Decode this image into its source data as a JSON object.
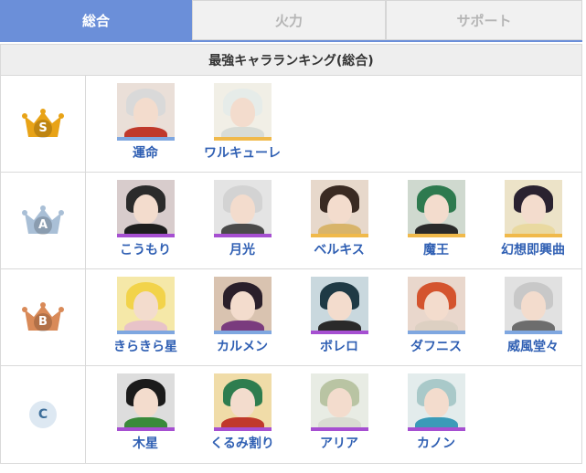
{
  "tabs": [
    {
      "label": "総合",
      "active": true
    },
    {
      "label": "火力",
      "active": false
    },
    {
      "label": "サポート",
      "active": false
    }
  ],
  "table_title": "最強キャラランキング(総合)",
  "tiers": [
    {
      "rank": "S",
      "icon": "gold-crown-icon",
      "color": "#e8a317",
      "characters": [
        {
          "name": "運命",
          "bar": "#7fa7e0",
          "hair": "#d9d9d9",
          "body": "#c0392b",
          "bg": "#eadfd8"
        },
        {
          "name": "ワルキューレ",
          "bar": "#f0b94a",
          "hair": "#e6ece9",
          "body": "#d8dcd6",
          "bg": "#f1efe6"
        }
      ]
    },
    {
      "rank": "A",
      "icon": "silver-crown-icon",
      "color": "#a9bfd6",
      "characters": [
        {
          "name": "こうもり",
          "bar": "#a64fd1",
          "hair": "#2b2b2b",
          "body": "#1e1e1e",
          "bg": "#d8cccc"
        },
        {
          "name": "月光",
          "bar": "#a64fd1",
          "hair": "#d3d3d3",
          "body": "#4a4a4a",
          "bg": "#e4e4e4"
        },
        {
          "name": "ベルキス",
          "bar": "#f0b94a",
          "hair": "#3a2a22",
          "body": "#d8b46a",
          "bg": "#e7d8cb"
        },
        {
          "name": "魔王",
          "bar": "#f0b94a",
          "hair": "#2e7a4f",
          "body": "#2a2a2a",
          "bg": "#cfd9cf"
        },
        {
          "name": "幻想即興曲",
          "bar": "#f0b94a",
          "hair": "#2a2230",
          "body": "#e9d9a0",
          "bg": "#ece3c8"
        }
      ]
    },
    {
      "rank": "B",
      "icon": "bronze-crown-icon",
      "color": "#d98a58",
      "characters": [
        {
          "name": "きらきら星",
          "bar": "#7fa7e0",
          "hair": "#f2d34a",
          "body": "#e8c3c8",
          "bg": "#f5e8a8"
        },
        {
          "name": "カルメン",
          "bar": "#7fa7e0",
          "hair": "#2a1f2a",
          "body": "#7a3b7e",
          "bg": "#d9c3b0"
        },
        {
          "name": "ボレロ",
          "bar": "#a64fd1",
          "hair": "#1f3a45",
          "body": "#2a2a2a",
          "bg": "#c9d8de"
        },
        {
          "name": "ダフニス",
          "bar": "#7fa7e0",
          "hair": "#d4542e",
          "body": "#ddd0c2",
          "bg": "#e9d7cc"
        },
        {
          "name": "威風堂々",
          "bar": "#7fa7e0",
          "hair": "#c8c8c8",
          "body": "#6d6d6d",
          "bg": "#e1e1e1"
        }
      ]
    },
    {
      "rank": "C",
      "icon": "c-rank-circle-icon",
      "color": "#3d6e9a",
      "characters": [
        {
          "name": "木星",
          "bar": "#a64fd1",
          "hair": "#1b1b1b",
          "body": "#3a8a3a",
          "bg": "#dddddd"
        },
        {
          "name": "くるみ割り",
          "bar": "#a64fd1",
          "hair": "#2e7d4f",
          "body": "#c0392b",
          "bg": "#f0dca8"
        },
        {
          "name": "アリア",
          "bar": "#a64fd1",
          "hair": "#b9c4a3",
          "body": "#d9dcd2",
          "bg": "#e8ece4"
        },
        {
          "name": "カノン",
          "bar": "#a64fd1",
          "hair": "#a9c9c9",
          "body": "#3b9bb8",
          "bg": "#e3ecec"
        }
      ]
    }
  ]
}
